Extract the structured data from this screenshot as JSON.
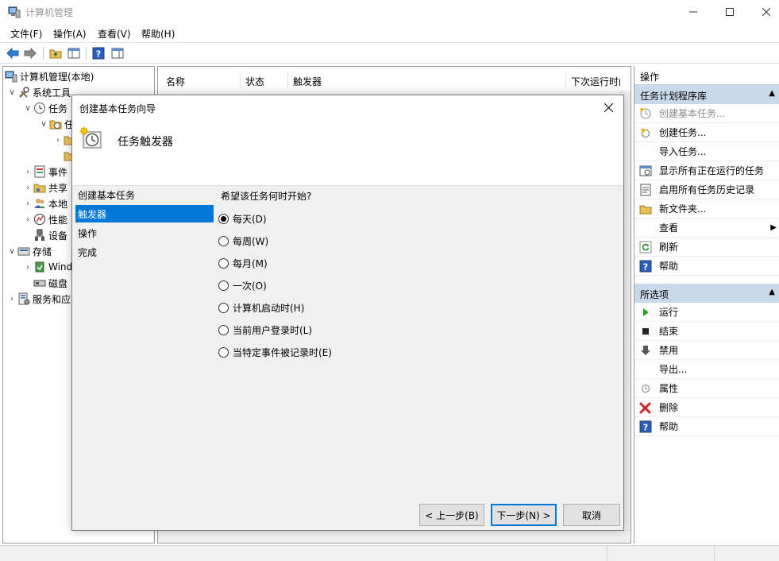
{
  "window": {
    "title": "计算机管理"
  },
  "menu": [
    "文件(F)",
    "操作(A)",
    "查看(V)",
    "帮助(H)"
  ],
  "tree": {
    "items": [
      {
        "label": "计算机管理(本地)",
        "indent": 0,
        "expander": ""
      },
      {
        "label": "系统工具",
        "indent": 1,
        "expander": "v"
      },
      {
        "label": "任务",
        "indent": 2,
        "expander": "v"
      },
      {
        "label": "任",
        "indent": 3,
        "expander": "v"
      },
      {
        "label": "",
        "indent": 4,
        "expander": ">"
      },
      {
        "label": "",
        "indent": 4,
        "expander": ""
      },
      {
        "label": "事件",
        "indent": 2,
        "expander": ">"
      },
      {
        "label": "共享",
        "indent": 2,
        "expander": ">"
      },
      {
        "label": "本地",
        "indent": 2,
        "expander": ">"
      },
      {
        "label": "性能",
        "indent": 2,
        "expander": ">"
      },
      {
        "label": "设备",
        "indent": 2,
        "expander": ""
      },
      {
        "label": "存储",
        "indent": 1,
        "expander": "v"
      },
      {
        "label": "Wind",
        "indent": 2,
        "expander": ">"
      },
      {
        "label": "磁盘",
        "indent": 2,
        "expander": ""
      },
      {
        "label": "服务和应",
        "indent": 1,
        "expander": ">"
      }
    ]
  },
  "middle": {
    "columns": [
      "名称",
      "状态",
      "触发器",
      "下次运行时间"
    ]
  },
  "actions": {
    "header": "操作",
    "section1": {
      "title": "任务计划程序库",
      "items": [
        {
          "label": "创建基本任务...",
          "icon": "create-basic-task-icon",
          "disabled": true
        },
        {
          "label": "创建任务...",
          "icon": "create-task-icon",
          "disabled": false
        },
        {
          "label": "导入任务...",
          "icon": "",
          "disabled": false
        },
        {
          "label": "显示所有正在运行的任务",
          "icon": "running-tasks-icon",
          "disabled": false
        },
        {
          "label": "启用所有任务历史记录",
          "icon": "history-icon",
          "disabled": false
        },
        {
          "label": "新文件夹...",
          "icon": "folder-icon",
          "disabled": false
        },
        {
          "label": "查看",
          "icon": "",
          "disabled": false,
          "submenu": true
        },
        {
          "label": "刷新",
          "icon": "refresh-icon",
          "disabled": false
        },
        {
          "label": "帮助",
          "icon": "help-icon",
          "disabled": false
        }
      ]
    },
    "section2": {
      "title": "所选项",
      "items": [
        {
          "label": "运行",
          "icon": "run-icon"
        },
        {
          "label": "结束",
          "icon": "stop-icon"
        },
        {
          "label": "禁用",
          "icon": "disable-icon"
        },
        {
          "label": "导出...",
          "icon": ""
        },
        {
          "label": "属性",
          "icon": "properties-icon"
        },
        {
          "label": "删除",
          "icon": "delete-icon"
        },
        {
          "label": "帮助",
          "icon": "help-icon"
        }
      ]
    }
  },
  "dialog": {
    "title": "创建基本任务向导",
    "header_title": "任务触发器",
    "steps": [
      {
        "label": "创建基本任务",
        "active": false
      },
      {
        "label": "触发器",
        "active": true
      },
      {
        "label": "操作",
        "active": false
      },
      {
        "label": "完成",
        "active": false
      }
    ],
    "question": "希望该任务何时开始?",
    "options": [
      {
        "label": "每天(D)",
        "checked": true
      },
      {
        "label": "每周(W)",
        "checked": false
      },
      {
        "label": "每月(M)",
        "checked": false
      },
      {
        "label": "一次(O)",
        "checked": false
      },
      {
        "label": "计算机启动时(H)",
        "checked": false
      },
      {
        "label": "当前用户登录时(L)",
        "checked": false
      },
      {
        "label": "当特定事件被记录时(E)",
        "checked": false
      }
    ],
    "buttons": {
      "back": "< 上一步(B)",
      "next": "下一步(N) >",
      "cancel": "取消"
    }
  },
  "colors": {
    "accent": "#0078d7",
    "section_bg": "#c9d9ec"
  }
}
